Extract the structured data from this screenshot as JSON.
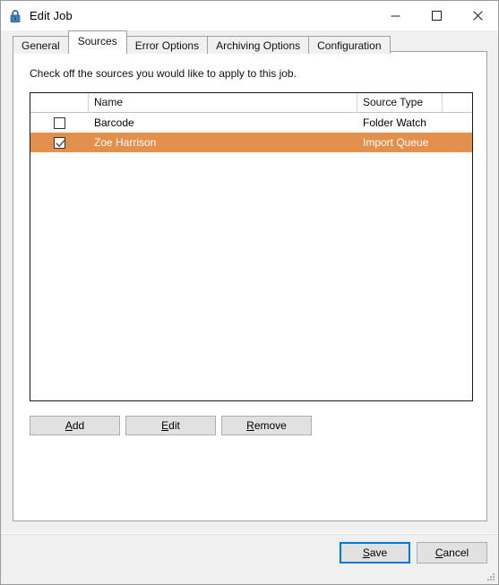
{
  "window": {
    "title": "Edit Job",
    "icon": "lock-icon",
    "controls": {
      "minimize": "minimize-icon",
      "maximize": "maximize-icon",
      "close": "close-icon"
    }
  },
  "tabs": [
    {
      "label": "General",
      "active": false
    },
    {
      "label": "Sources",
      "active": true
    },
    {
      "label": "Error Options",
      "active": false
    },
    {
      "label": "Archiving Options",
      "active": false
    },
    {
      "label": "Configuration",
      "active": false
    }
  ],
  "panel": {
    "instruction": "Check off the sources you would like to apply to this job."
  },
  "list": {
    "columns": [
      "",
      "Name",
      "Source Type",
      ""
    ],
    "rows": [
      {
        "checked": false,
        "name": "Barcode",
        "source_type": "Folder Watch",
        "selected": false
      },
      {
        "checked": true,
        "name": "Zoe Harrison",
        "source_type": "Import Queue",
        "selected": true
      }
    ]
  },
  "actions": {
    "add": {
      "prefix": "",
      "mnemonic": "A",
      "suffix": "dd"
    },
    "edit": {
      "prefix": "",
      "mnemonic": "E",
      "suffix": "dit"
    },
    "remove": {
      "prefix": "",
      "mnemonic": "R",
      "suffix": "emove"
    }
  },
  "footer": {
    "save": {
      "prefix": "",
      "mnemonic": "S",
      "suffix": "ave"
    },
    "cancel": {
      "prefix": "",
      "mnemonic": "C",
      "suffix": "ancel"
    }
  },
  "colors": {
    "selection": "#e2904c",
    "focus": "#0078d7",
    "window_bg": "#f0f0f0",
    "panel_bg": "#ffffff"
  }
}
